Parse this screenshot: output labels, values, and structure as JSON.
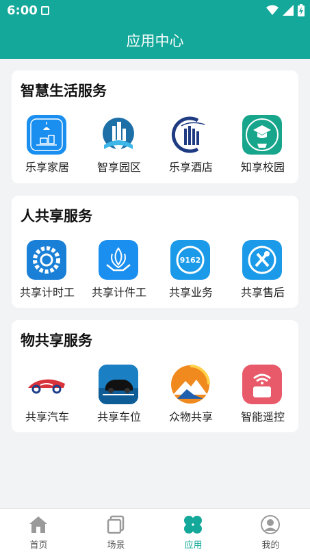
{
  "status": {
    "time": "6:00"
  },
  "header": {
    "title": "应用中心"
  },
  "sections": [
    {
      "title": "智慧生活服务",
      "items": [
        {
          "label": "乐享家居",
          "icon": "smart-home-icon"
        },
        {
          "label": "智享园区",
          "icon": "park-icon"
        },
        {
          "label": "乐享酒店",
          "icon": "hotel-icon"
        },
        {
          "label": "知享校园",
          "icon": "campus-icon"
        }
      ]
    },
    {
      "title": "人共享服务",
      "items": [
        {
          "label": "共享计时工",
          "icon": "hourly-worker-icon"
        },
        {
          "label": "共享计件工",
          "icon": "piece-worker-icon"
        },
        {
          "label": "共享业务",
          "icon": "business-icon",
          "text": "9162"
        },
        {
          "label": "共享售后",
          "icon": "after-sales-icon"
        }
      ]
    },
    {
      "title": "物共享服务",
      "items": [
        {
          "label": "共享汽车",
          "icon": "car-icon"
        },
        {
          "label": "共享车位",
          "icon": "parking-icon"
        },
        {
          "label": "众物共享",
          "icon": "goods-share-icon"
        },
        {
          "label": "智能遥控",
          "icon": "remote-control-icon"
        }
      ]
    }
  ],
  "tabs": [
    {
      "label": "首页",
      "icon": "home-icon"
    },
    {
      "label": "场景",
      "icon": "scene-icon"
    },
    {
      "label": "应用",
      "icon": "apps-icon",
      "active": true
    },
    {
      "label": "我的",
      "icon": "profile-icon"
    }
  ],
  "colors": {
    "accent": "#14a89a",
    "background": "#f2f3f5"
  }
}
